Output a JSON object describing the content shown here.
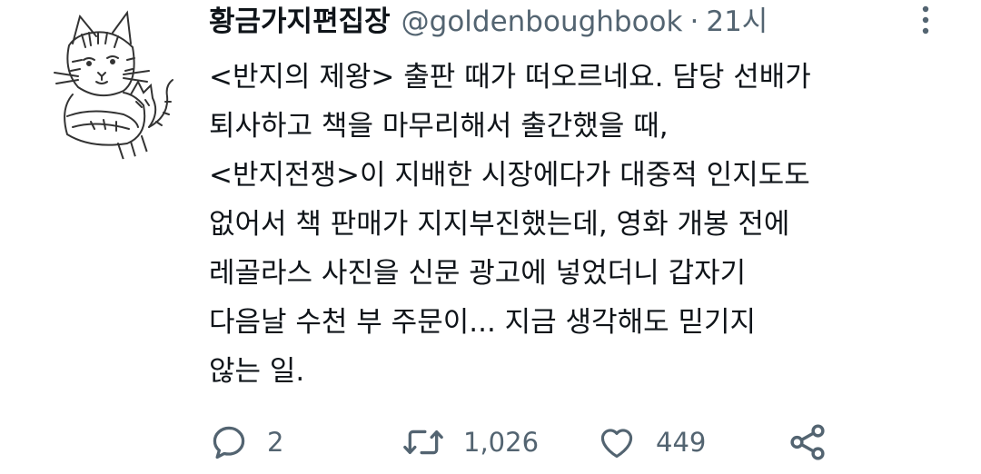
{
  "author": {
    "display_name": "황금가지편집장",
    "handle": "@goldenboughbook",
    "separator": "·",
    "time": "21시"
  },
  "avatar": {
    "icon": "cat-drawing-avatar"
  },
  "more_icon": "more-vertical-icon",
  "body_lines": [
    "<반지의 제왕> 출판 때가 떠오르네요. 담당 선배가",
    "퇴사하고 책을 마무리해서 출간했을 때,",
    "<반지전쟁>이 지배한 시장에다가 대중적 인지도도",
    "없어서 책 판매가 지지부진했는데, 영화 개봉 전에",
    "레골라스 사진을 신문 광고에 넣었더니 갑자기",
    "다음날 수천 부 주문이... 지금 생각해도 믿기지",
    "않는 일."
  ],
  "actions": {
    "reply": {
      "icon": "reply-icon",
      "count": "2"
    },
    "retweet": {
      "icon": "retweet-icon",
      "count": "1,026"
    },
    "like": {
      "icon": "heart-icon",
      "count": "449"
    },
    "share": {
      "icon": "share-icon"
    }
  },
  "colors": {
    "text": "#0f1419",
    "secondary": "#536471",
    "background": "#ffffff"
  }
}
